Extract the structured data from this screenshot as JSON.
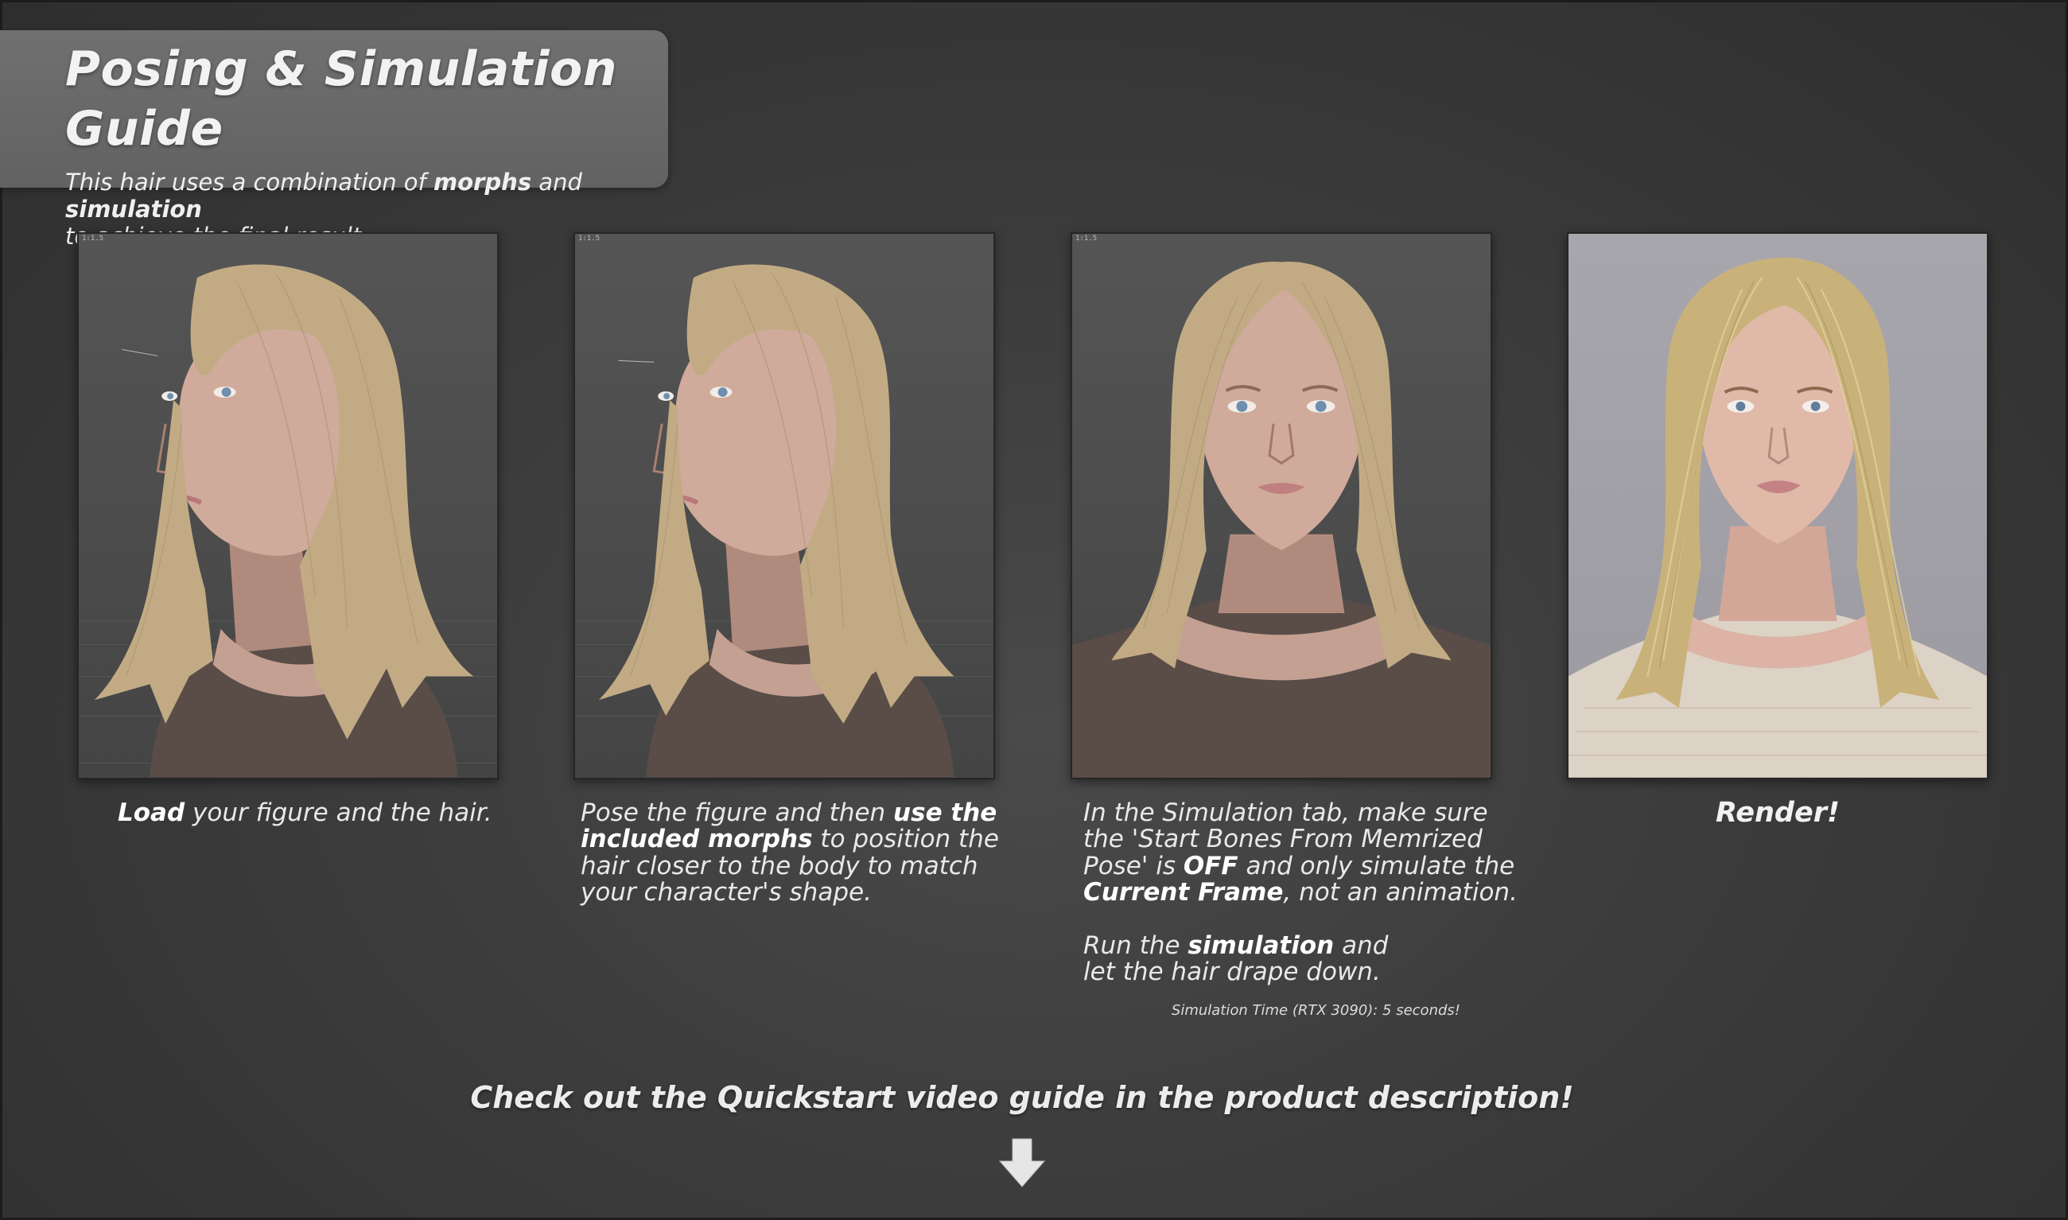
{
  "header": {
    "title": "Posing & Simulation Guide",
    "subtitle": {
      "pre": "This hair uses a combination of ",
      "bold1": "morphs",
      "mid": " and ",
      "bold2": "simulation",
      "post": "to achieve the final result."
    }
  },
  "panels": [
    {
      "viewport_label": "1:1.5"
    },
    {
      "viewport_label": "1:1.5"
    },
    {
      "viewport_label": "1:1.5"
    },
    {
      "viewport_label": ""
    }
  ],
  "steps": {
    "step1": {
      "bold": "Load",
      "text": " your figure and the hair."
    },
    "step2": {
      "pre": "Pose the figure and then ",
      "bold": "use the included morphs",
      "post": " to position the hair closer to the body to match your character's shape."
    },
    "step3": {
      "p1_pre": "In the Simulation tab, make sure the 'Start Bones From Memrized Pose' is ",
      "p1_bold1": "OFF",
      "p1_mid": " and only simulate the ",
      "p1_bold2": "Current Frame",
      "p1_post": ", not an animation.",
      "p2_pre": "Run the ",
      "p2_bold": "simulation",
      "p2_post": " and let the hair drape down.",
      "sim_time": "Simulation Time (RTX 3090): 5 seconds!"
    },
    "step4": {
      "label": "Render!"
    }
  },
  "footer": {
    "cta": "Check out the Quickstart video guide in the product description!",
    "arrow_icon": "arrow-down-icon"
  },
  "colors": {
    "background": "#3c3c3c",
    "title_card": "#6a6a6a",
    "hair_viewport": "#c2ab84",
    "hair_render": "#c9b27a",
    "skin": "#c79d8c"
  }
}
